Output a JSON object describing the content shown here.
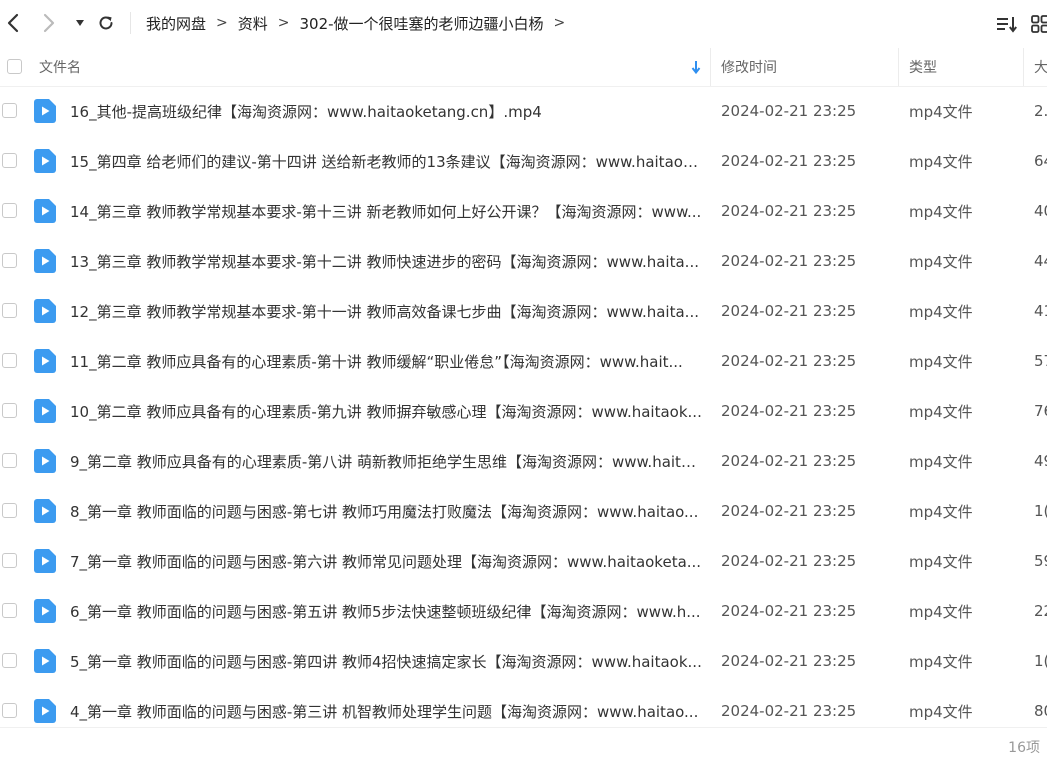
{
  "toolbar": {
    "back_icon": "chevron-left-icon",
    "forward_icon": "chevron-right-icon",
    "dropdown_icon": "caret-down-icon",
    "refresh_icon": "refresh-icon",
    "sort_icon": "sort-list-icon",
    "view_icon": "grid-view-icon"
  },
  "breadcrumb": [
    "我的网盘",
    "资料",
    "302-做一个很哇塞的老师边疆小白杨"
  ],
  "columns": {
    "name": "文件名",
    "modified": "修改时间",
    "type": "类型",
    "size": "大"
  },
  "files": [
    {
      "name": "16_其他-提高班级纪律【海淘资源网：www.haitaoketang.cn】.mp4",
      "modified": "2024-02-21 23:25",
      "type": "mp4文件",
      "size": "2."
    },
    {
      "name": "15_第四章 给老师们的建议-第十四讲 送给新老教师的13条建议【海淘资源网：www.haitaok...",
      "modified": "2024-02-21 23:25",
      "type": "mp4文件",
      "size": "64"
    },
    {
      "name": "14_第三章 教师教学常规基本要求-第十三讲 新老教师如何上好公开课？【海淘资源网：www...",
      "modified": "2024-02-21 23:25",
      "type": "mp4文件",
      "size": "40"
    },
    {
      "name": "13_第三章 教师教学常规基本要求-第十二讲 教师快速进步的密码【海淘资源网：www.haita...",
      "modified": "2024-02-21 23:25",
      "type": "mp4文件",
      "size": "44"
    },
    {
      "name": "12_第三章 教师教学常规基本要求-第十一讲 教师高效备课七步曲【海淘资源网：www.haita...",
      "modified": "2024-02-21 23:25",
      "type": "mp4文件",
      "size": "41"
    },
    {
      "name": "11_第二章 教师应具备有的心理素质-第十讲 教师缓解“职业倦怠”【海淘资源网：www.hait...",
      "modified": "2024-02-21 23:25",
      "type": "mp4文件",
      "size": "57"
    },
    {
      "name": "10_第二章 教师应具备有的心理素质-第九讲 教师摒弃敏感心理【海淘资源网：www.haitaok...",
      "modified": "2024-02-21 23:25",
      "type": "mp4文件",
      "size": "76"
    },
    {
      "name": "9_第二章 教师应具备有的心理素质-第八讲 萌新教师拒绝学生思维【海淘资源网：www.haita...",
      "modified": "2024-02-21 23:25",
      "type": "mp4文件",
      "size": "49"
    },
    {
      "name": "8_第一章 教师面临的问题与困惑-第七讲 教师巧用魔法打败魔法【海淘资源网：www.haitao...",
      "modified": "2024-02-21 23:25",
      "type": "mp4文件",
      "size": "1("
    },
    {
      "name": "7_第一章 教师面临的问题与困惑-第六讲 教师常见问题处理【海淘资源网：www.haitaoketa...",
      "modified": "2024-02-21 23:25",
      "type": "mp4文件",
      "size": "59"
    },
    {
      "name": "6_第一章 教师面临的问题与困惑-第五讲 教师5步法快速整顿班级纪律【海淘资源网：www.h...",
      "modified": "2024-02-21 23:25",
      "type": "mp4文件",
      "size": "22"
    },
    {
      "name": "5_第一章 教师面临的问题与困惑-第四讲 教师4招快速搞定家长【海淘资源网：www.haitaok...",
      "modified": "2024-02-21 23:25",
      "type": "mp4文件",
      "size": "1("
    },
    {
      "name": "4_第一章 教师面临的问题与困惑-第三讲 机智教师处理学生问题【海淘资源网：www.haitao...",
      "modified": "2024-02-21 23:25",
      "type": "mp4文件",
      "size": "80"
    }
  ],
  "footer": {
    "count": "16项"
  },
  "colors": {
    "accent": "#2f8ff0",
    "video_icon": "#3c9bf0"
  }
}
